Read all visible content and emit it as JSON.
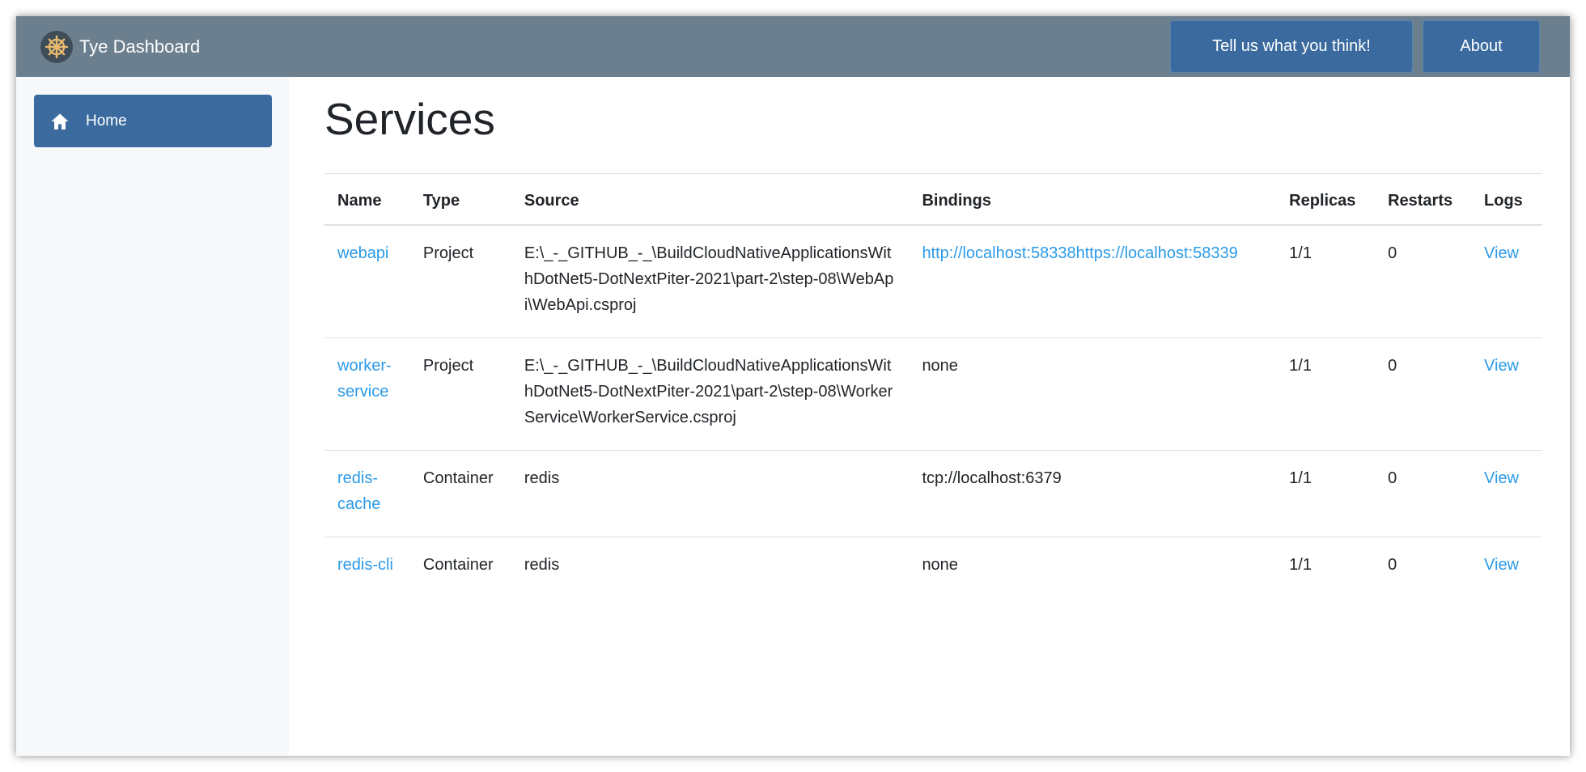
{
  "header": {
    "title": "Tye Dashboard",
    "feedback_label": "Tell us what you think!",
    "about_label": "About"
  },
  "sidebar": {
    "items": [
      {
        "label": "Home",
        "icon": "home-icon"
      }
    ]
  },
  "main": {
    "title": "Services",
    "columns": [
      "Name",
      "Type",
      "Source",
      "Bindings",
      "Replicas",
      "Restarts",
      "Logs"
    ],
    "rows": [
      {
        "name": "webapi",
        "type": "Project",
        "source": "E:\\_-_GITHUB_-_\\BuildCloudNativeApplicationsWithDotNet5-DotNextPiter-2021\\part-2\\step-08\\WebApi\\WebApi.csproj",
        "bindings": "http://localhost:58338https://localhost:58339",
        "replicas": "1/1",
        "restarts": "0",
        "logs": "View"
      },
      {
        "name": "worker-service",
        "type": "Project",
        "source": "E:\\_-_GITHUB_-_\\BuildCloudNativeApplicationsWithDotNet5-DotNextPiter-2021\\part-2\\step-08\\WorkerService\\WorkerService.csproj",
        "bindings": "none",
        "replicas": "1/1",
        "restarts": "0",
        "logs": "View"
      },
      {
        "name": "redis-cache",
        "type": "Container",
        "source": "redis",
        "bindings": "tcp://localhost:6379",
        "replicas": "1/1",
        "restarts": "0",
        "logs": "View"
      },
      {
        "name": "redis-cli",
        "type": "Container",
        "source": "redis",
        "bindings": "none",
        "replicas": "1/1",
        "restarts": "0",
        "logs": "View"
      }
    ]
  },
  "colors": {
    "topbar": "#6c7f8e",
    "accent": "#3a6a9e",
    "link": "#2b9ae8",
    "sidebar": "#f6f8fa"
  }
}
